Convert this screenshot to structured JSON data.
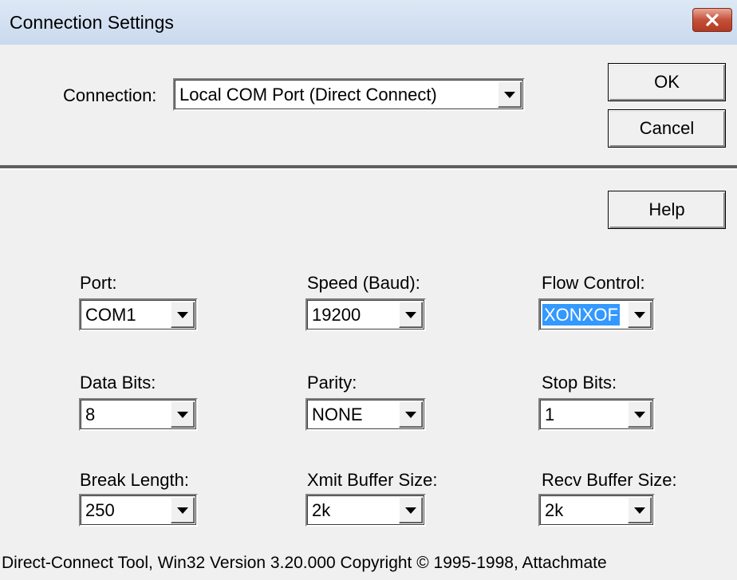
{
  "window": {
    "title": "Connection Settings"
  },
  "connection": {
    "label": "Connection:",
    "value": "Local COM Port (Direct Connect)"
  },
  "buttons": {
    "ok": "OK",
    "cancel": "Cancel",
    "help": "Help"
  },
  "fields": {
    "port": {
      "label": "Port:",
      "value": "COM1"
    },
    "speed": {
      "label": "Speed (Baud):",
      "value": "19200"
    },
    "flow_control": {
      "label": "Flow Control:",
      "value": "XONXOF"
    },
    "data_bits": {
      "label": "Data Bits:",
      "value": "8"
    },
    "parity": {
      "label": "Parity:",
      "value": "NONE"
    },
    "stop_bits": {
      "label": "Stop Bits:",
      "value": "1"
    },
    "break_length": {
      "label": "Break Length:",
      "value": "250"
    },
    "xmit_buffer": {
      "label": "Xmit Buffer Size:",
      "value": "2k"
    },
    "recv_buffer": {
      "label": "Recv Buffer Size:",
      "value": "2k"
    }
  },
  "footer": {
    "text": "Direct-Connect Tool, Win32 Version 3.20.000 Copyright © 1995-1998, Attachmate"
  },
  "colors": {
    "selection": "#3399ff",
    "close_button": "#c4503a"
  }
}
